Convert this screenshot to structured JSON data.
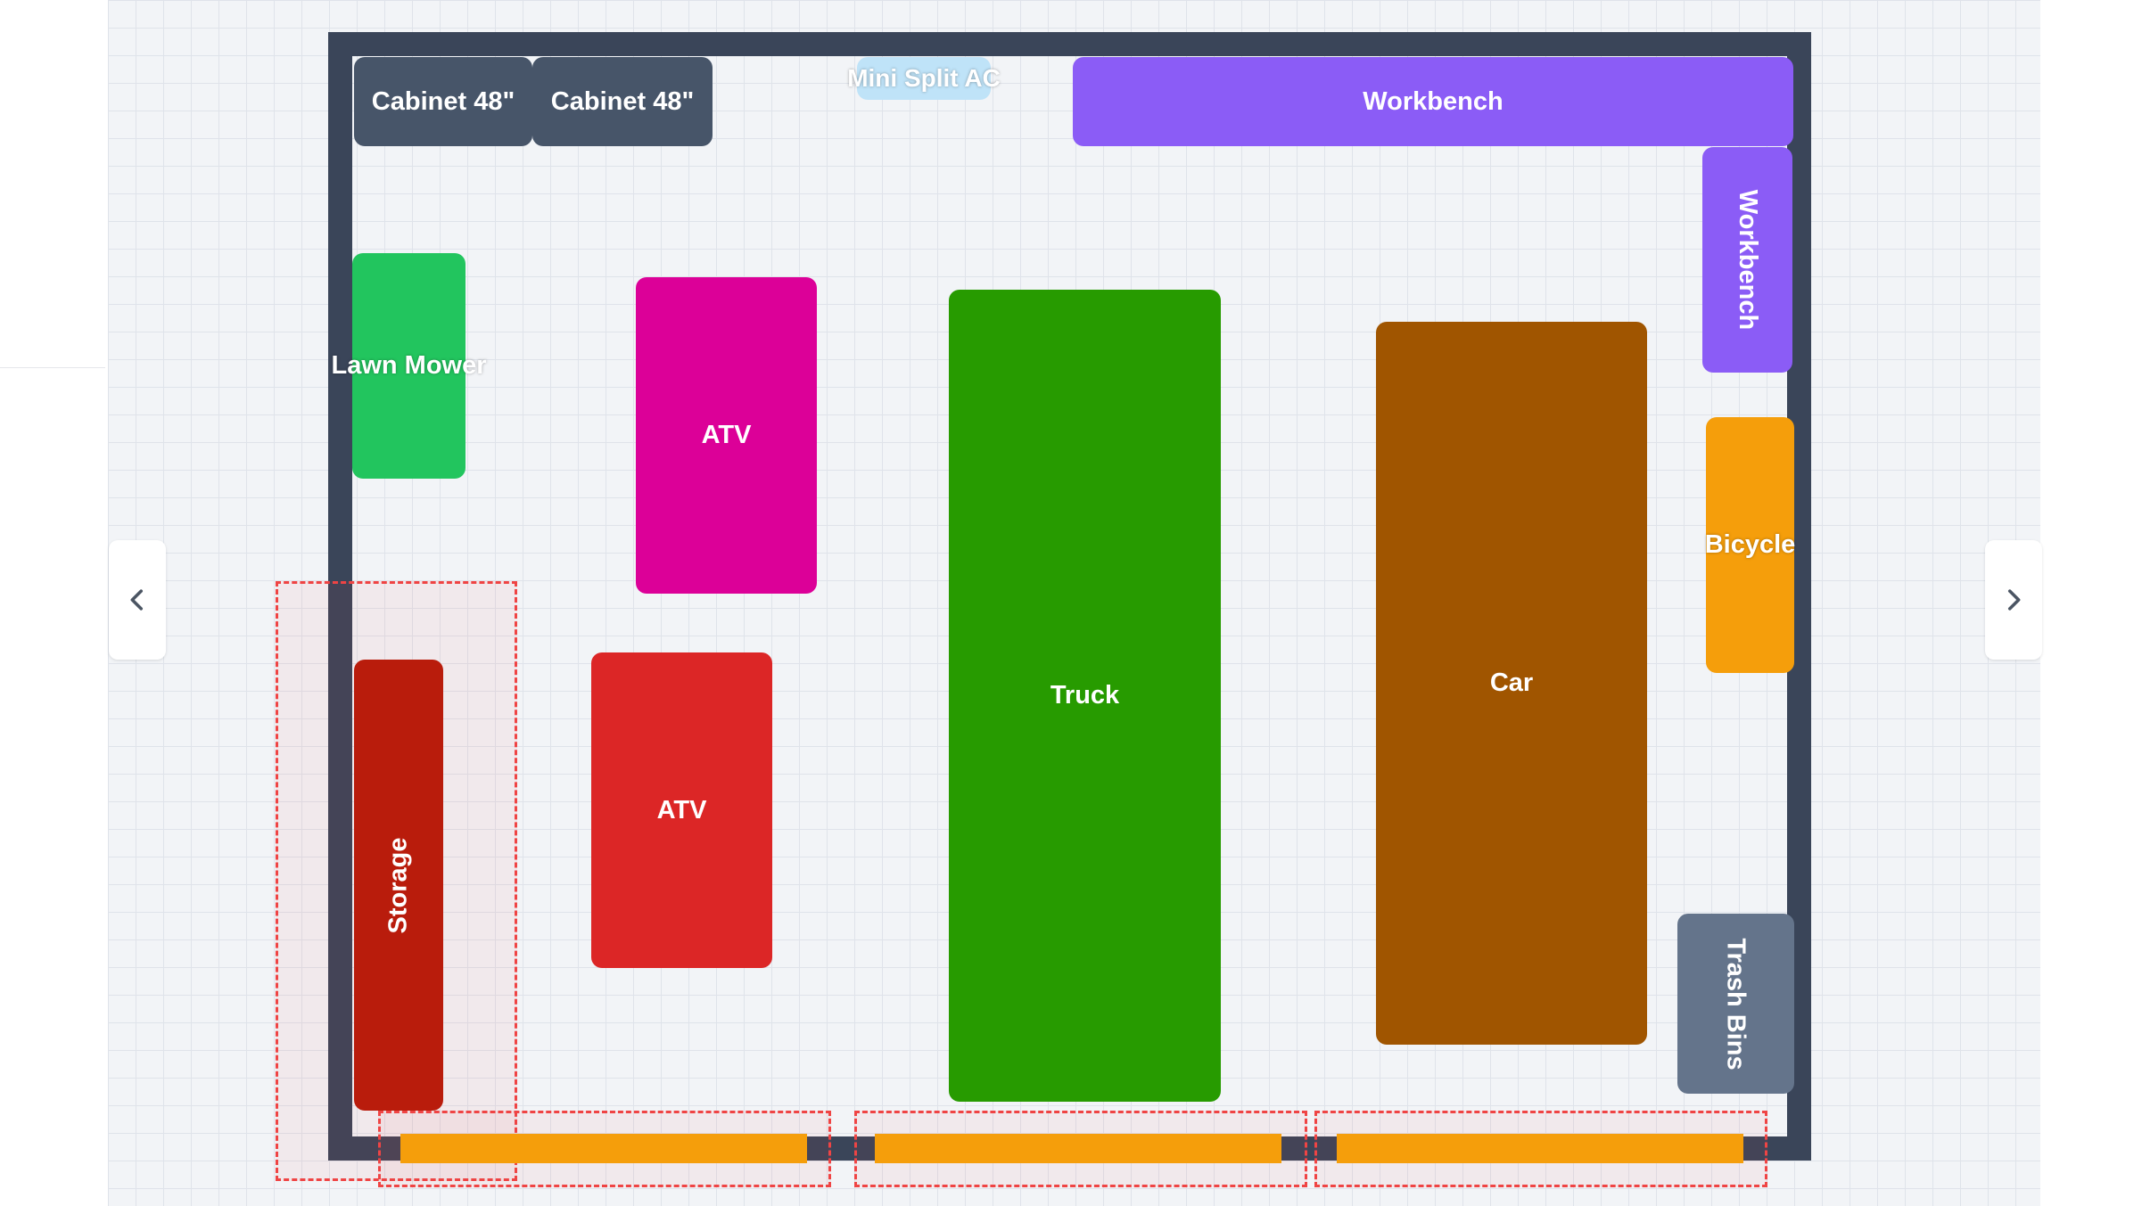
{
  "layout_items": {
    "cabinet_1": {
      "label": "Cabinet 48\"",
      "color": "#475569"
    },
    "cabinet_2": {
      "label": "Cabinet 48\"",
      "color": "#475569"
    },
    "mini_split": {
      "label": "Mini Split AC",
      "color": "#bfe3f8"
    },
    "workbench_top": {
      "label": "Workbench",
      "color": "#8b5cf6"
    },
    "workbench_side": {
      "label": "Workbench",
      "color": "#8b5cf6"
    },
    "lawn_mower": {
      "label": "Lawn Mower",
      "color": "#22c55e"
    },
    "atv_top": {
      "label": "ATV",
      "color": "#dc0098"
    },
    "truck": {
      "label": "Truck",
      "color": "#279b00"
    },
    "car": {
      "label": "Car",
      "color": "#a05500"
    },
    "bicycle": {
      "label": "Bicycle",
      "color": "#f59e0b"
    },
    "storage": {
      "label": "Storage",
      "color": "#b91c0c"
    },
    "atv_bottom": {
      "label": "ATV",
      "color": "#dc2626"
    },
    "trash_bins": {
      "label": "Trash Bins",
      "color": "#64748b"
    }
  },
  "navigation": {
    "prev_icon": "chevron-left-icon",
    "next_icon": "chevron-right-icon"
  },
  "colors": {
    "wall": "#3a4559",
    "door": "#f59e0b",
    "zone_outline": "#ef4444",
    "grid_bg": "#f2f4f7"
  }
}
